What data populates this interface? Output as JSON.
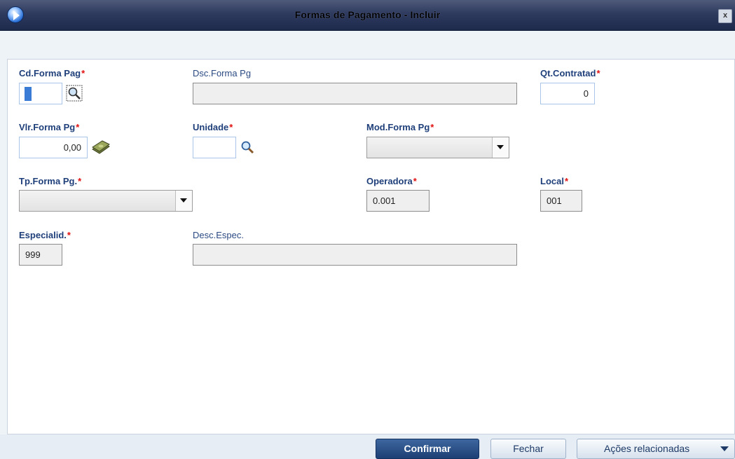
{
  "window": {
    "title": "Formas de Pagamento - Incluir",
    "close_label": "x"
  },
  "fields": {
    "cd_forma_pag": {
      "label": "Cd.Forma Pag",
      "required": "*",
      "value": ""
    },
    "dsc_forma_pg": {
      "label": "Dsc.Forma Pg",
      "value": ""
    },
    "qt_contratad": {
      "label": "Qt.Contratad",
      "required": "*",
      "value": "0"
    },
    "vlr_forma_pg": {
      "label": "Vlr.Forma Pg",
      "required": "*",
      "value": "0,00"
    },
    "unidade": {
      "label": "Unidade",
      "required": "*",
      "value": ""
    },
    "mod_forma_pg": {
      "label": "Mod.Forma Pg",
      "required": "*",
      "selected": ""
    },
    "tp_forma_pg": {
      "label": "Tp.Forma Pg.",
      "required": "*",
      "selected": ""
    },
    "operadora": {
      "label": "Operadora",
      "required": "*",
      "value": "0.001"
    },
    "local": {
      "label": "Local",
      "required": "*",
      "value": "001"
    },
    "especialid": {
      "label": "Especialid.",
      "required": "*",
      "value": "999"
    },
    "desc_espec": {
      "label": "Desc.Espec.",
      "value": ""
    }
  },
  "buttons": {
    "confirm": "Confirmar",
    "close": "Fechar",
    "related_actions": "Ações relacionadas"
  },
  "icons": {
    "app": "app-logo-icon",
    "search": "magnifier-search-icon",
    "money": "money-bills-icon",
    "dropdown": "chevron-down-icon"
  },
  "colors": {
    "title_bar": "#2e3a5e",
    "label": "#1f3f7a",
    "required": "#e01010",
    "primary_button": "#1c3f74"
  }
}
